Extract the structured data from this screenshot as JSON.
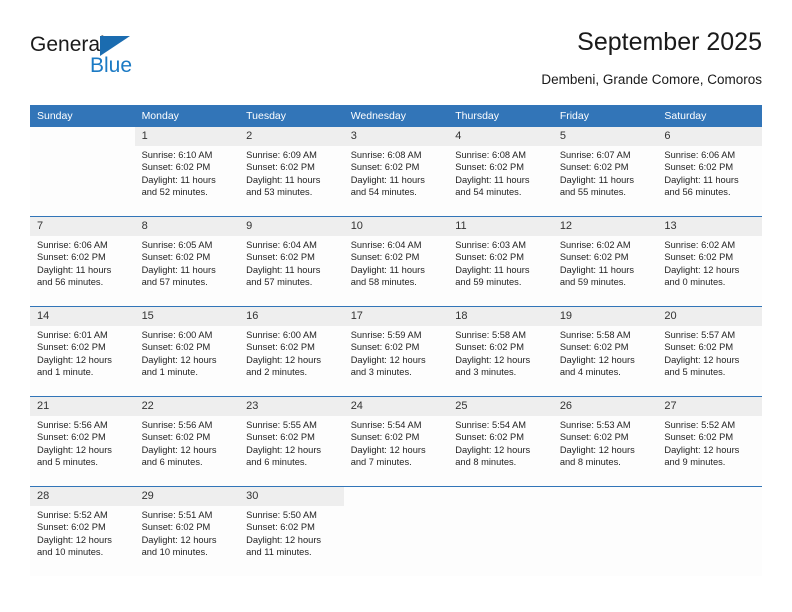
{
  "brand": {
    "name_primary": "General",
    "name_secondary": "Blue",
    "accent_color": "#1b7ac4",
    "triangle_color": "#1b6cb0"
  },
  "header": {
    "title": "September 2025",
    "subtitle": "Dembeni, Grande Comore, Comoros",
    "header_bg_color": "#3275b8",
    "daynum_bg_color": "#eeeeee"
  },
  "weekdays": [
    "Sunday",
    "Monday",
    "Tuesday",
    "Wednesday",
    "Thursday",
    "Friday",
    "Saturday"
  ],
  "weeks": [
    [
      {
        "day": "",
        "sunrise": "",
        "sunset": "",
        "daylight": ""
      },
      {
        "day": "1",
        "sunrise": "Sunrise: 6:10 AM",
        "sunset": "Sunset: 6:02 PM",
        "daylight": "Daylight: 11 hours and 52 minutes."
      },
      {
        "day": "2",
        "sunrise": "Sunrise: 6:09 AM",
        "sunset": "Sunset: 6:02 PM",
        "daylight": "Daylight: 11 hours and 53 minutes."
      },
      {
        "day": "3",
        "sunrise": "Sunrise: 6:08 AM",
        "sunset": "Sunset: 6:02 PM",
        "daylight": "Daylight: 11 hours and 54 minutes."
      },
      {
        "day": "4",
        "sunrise": "Sunrise: 6:08 AM",
        "sunset": "Sunset: 6:02 PM",
        "daylight": "Daylight: 11 hours and 54 minutes."
      },
      {
        "day": "5",
        "sunrise": "Sunrise: 6:07 AM",
        "sunset": "Sunset: 6:02 PM",
        "daylight": "Daylight: 11 hours and 55 minutes."
      },
      {
        "day": "6",
        "sunrise": "Sunrise: 6:06 AM",
        "sunset": "Sunset: 6:02 PM",
        "daylight": "Daylight: 11 hours and 56 minutes."
      }
    ],
    [
      {
        "day": "7",
        "sunrise": "Sunrise: 6:06 AM",
        "sunset": "Sunset: 6:02 PM",
        "daylight": "Daylight: 11 hours and 56 minutes."
      },
      {
        "day": "8",
        "sunrise": "Sunrise: 6:05 AM",
        "sunset": "Sunset: 6:02 PM",
        "daylight": "Daylight: 11 hours and 57 minutes."
      },
      {
        "day": "9",
        "sunrise": "Sunrise: 6:04 AM",
        "sunset": "Sunset: 6:02 PM",
        "daylight": "Daylight: 11 hours and 57 minutes."
      },
      {
        "day": "10",
        "sunrise": "Sunrise: 6:04 AM",
        "sunset": "Sunset: 6:02 PM",
        "daylight": "Daylight: 11 hours and 58 minutes."
      },
      {
        "day": "11",
        "sunrise": "Sunrise: 6:03 AM",
        "sunset": "Sunset: 6:02 PM",
        "daylight": "Daylight: 11 hours and 59 minutes."
      },
      {
        "day": "12",
        "sunrise": "Sunrise: 6:02 AM",
        "sunset": "Sunset: 6:02 PM",
        "daylight": "Daylight: 11 hours and 59 minutes."
      },
      {
        "day": "13",
        "sunrise": "Sunrise: 6:02 AM",
        "sunset": "Sunset: 6:02 PM",
        "daylight": "Daylight: 12 hours and 0 minutes."
      }
    ],
    [
      {
        "day": "14",
        "sunrise": "Sunrise: 6:01 AM",
        "sunset": "Sunset: 6:02 PM",
        "daylight": "Daylight: 12 hours and 1 minute."
      },
      {
        "day": "15",
        "sunrise": "Sunrise: 6:00 AM",
        "sunset": "Sunset: 6:02 PM",
        "daylight": "Daylight: 12 hours and 1 minute."
      },
      {
        "day": "16",
        "sunrise": "Sunrise: 6:00 AM",
        "sunset": "Sunset: 6:02 PM",
        "daylight": "Daylight: 12 hours and 2 minutes."
      },
      {
        "day": "17",
        "sunrise": "Sunrise: 5:59 AM",
        "sunset": "Sunset: 6:02 PM",
        "daylight": "Daylight: 12 hours and 3 minutes."
      },
      {
        "day": "18",
        "sunrise": "Sunrise: 5:58 AM",
        "sunset": "Sunset: 6:02 PM",
        "daylight": "Daylight: 12 hours and 3 minutes."
      },
      {
        "day": "19",
        "sunrise": "Sunrise: 5:58 AM",
        "sunset": "Sunset: 6:02 PM",
        "daylight": "Daylight: 12 hours and 4 minutes."
      },
      {
        "day": "20",
        "sunrise": "Sunrise: 5:57 AM",
        "sunset": "Sunset: 6:02 PM",
        "daylight": "Daylight: 12 hours and 5 minutes."
      }
    ],
    [
      {
        "day": "21",
        "sunrise": "Sunrise: 5:56 AM",
        "sunset": "Sunset: 6:02 PM",
        "daylight": "Daylight: 12 hours and 5 minutes."
      },
      {
        "day": "22",
        "sunrise": "Sunrise: 5:56 AM",
        "sunset": "Sunset: 6:02 PM",
        "daylight": "Daylight: 12 hours and 6 minutes."
      },
      {
        "day": "23",
        "sunrise": "Sunrise: 5:55 AM",
        "sunset": "Sunset: 6:02 PM",
        "daylight": "Daylight: 12 hours and 6 minutes."
      },
      {
        "day": "24",
        "sunrise": "Sunrise: 5:54 AM",
        "sunset": "Sunset: 6:02 PM",
        "daylight": "Daylight: 12 hours and 7 minutes."
      },
      {
        "day": "25",
        "sunrise": "Sunrise: 5:54 AM",
        "sunset": "Sunset: 6:02 PM",
        "daylight": "Daylight: 12 hours and 8 minutes."
      },
      {
        "day": "26",
        "sunrise": "Sunrise: 5:53 AM",
        "sunset": "Sunset: 6:02 PM",
        "daylight": "Daylight: 12 hours and 8 minutes."
      },
      {
        "day": "27",
        "sunrise": "Sunrise: 5:52 AM",
        "sunset": "Sunset: 6:02 PM",
        "daylight": "Daylight: 12 hours and 9 minutes."
      }
    ],
    [
      {
        "day": "28",
        "sunrise": "Sunrise: 5:52 AM",
        "sunset": "Sunset: 6:02 PM",
        "daylight": "Daylight: 12 hours and 10 minutes."
      },
      {
        "day": "29",
        "sunrise": "Sunrise: 5:51 AM",
        "sunset": "Sunset: 6:02 PM",
        "daylight": "Daylight: 12 hours and 10 minutes."
      },
      {
        "day": "30",
        "sunrise": "Sunrise: 5:50 AM",
        "sunset": "Sunset: 6:02 PM",
        "daylight": "Daylight: 12 hours and 11 minutes."
      },
      {
        "day": "",
        "sunrise": "",
        "sunset": "",
        "daylight": ""
      },
      {
        "day": "",
        "sunrise": "",
        "sunset": "",
        "daylight": ""
      },
      {
        "day": "",
        "sunrise": "",
        "sunset": "",
        "daylight": ""
      },
      {
        "day": "",
        "sunrise": "",
        "sunset": "",
        "daylight": ""
      }
    ]
  ]
}
